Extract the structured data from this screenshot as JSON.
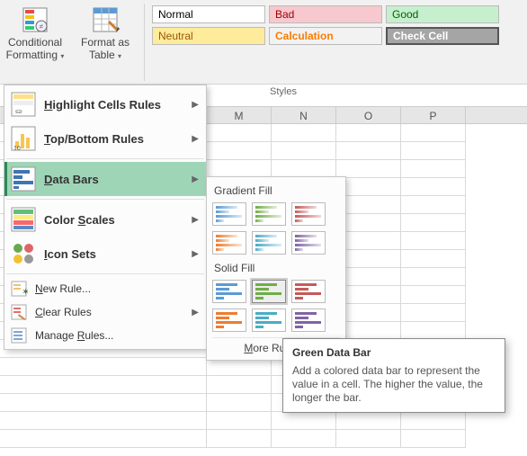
{
  "ribbon": {
    "conditional_formatting": {
      "line1": "Conditional",
      "line2": "Formatting"
    },
    "format_as_table": {
      "line1": "Format as",
      "line2": "Table"
    },
    "styles_label": "Styles",
    "cell_styles": {
      "normal": "Normal",
      "bad": "Bad",
      "good": "Good",
      "neutral": "Neutral",
      "calculation": "Calculation",
      "check_cell": "Check Cell"
    }
  },
  "columns": [
    "M",
    "N",
    "O",
    "P"
  ],
  "menu": {
    "highlight_cells": {
      "pre": "",
      "u": "H",
      "post": "ighlight Cells Rules",
      "bold": true
    },
    "top_bottom": {
      "pre": "",
      "u": "T",
      "post": "op/Bottom Rules",
      "bold": true
    },
    "data_bars": {
      "pre": "",
      "u": "D",
      "post": "ata Bars",
      "bold": true
    },
    "color_scales": {
      "pre": "Color ",
      "u": "S",
      "post": "cales",
      "bold": true
    },
    "icon_sets": {
      "pre": "",
      "u": "I",
      "post": "con Sets",
      "bold": true
    },
    "new_rule": {
      "pre": "",
      "u": "N",
      "post": "ew Rule..."
    },
    "clear_rules": {
      "pre": "",
      "u": "C",
      "post": "lear Rules"
    },
    "manage_rules": {
      "pre": "Manage ",
      "u": "R",
      "post": "ules..."
    }
  },
  "submenu": {
    "gradient_heading": "Gradient Fill",
    "solid_heading": "Solid Fill",
    "more_pre": "",
    "more_u": "M",
    "more_post": "ore Rules...",
    "gradient_colors": [
      [
        "#4f81bd",
        "#9bbb59",
        "#c0504d"
      ],
      [
        "#f79646",
        "#8064a2",
        "#d24option"
      ]
    ],
    "row1": {
      "blue": "#5b9bd5",
      "green": "#70ad47",
      "red": "#c55a5a"
    },
    "row2": {
      "orange": "#ed7d31",
      "purple": "#7f6aa3",
      "pink": "#d16ba5"
    }
  },
  "tooltip": {
    "title": "Green Data Bar",
    "body": "Add a colored data bar to represent the value in a cell. The higher the value, the longer the bar."
  }
}
